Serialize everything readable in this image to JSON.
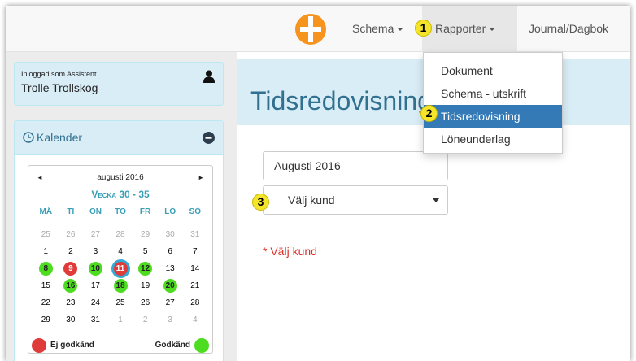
{
  "navbar": {
    "menu_items": [
      {
        "label": "Schema"
      },
      {
        "label": "Rapporter"
      },
      {
        "label": "Journal/Dagbok"
      }
    ]
  },
  "dropdown": {
    "items": [
      {
        "label": "Dokument"
      },
      {
        "label": "Schema - utskrift"
      },
      {
        "label": "Tidsredovisning",
        "active": true
      },
      {
        "label": "Löneunderlag"
      }
    ]
  },
  "markers": [
    "1",
    "2",
    "3"
  ],
  "user_panel": {
    "logged_in_label": "Inloggad som Assistent",
    "name": "Trolle Trollskog",
    "icon": "user-icon"
  },
  "calendar_panel": {
    "title": "Kalender",
    "month_label": "augusti 2016",
    "week_label": "Vecka 30 - 35",
    "weekdays": [
      "MÅ",
      "TI",
      "ON",
      "TO",
      "FR",
      "LÖ",
      "SÖ"
    ],
    "weeks": [
      [
        "25",
        "26",
        "27",
        "28",
        "29",
        "30",
        "31"
      ],
      [
        "1",
        "2",
        "3",
        "4",
        "5",
        "6",
        "7"
      ],
      [
        "8",
        "9",
        "10",
        "11",
        "12",
        "13",
        "14"
      ],
      [
        "15",
        "16",
        "17",
        "18",
        "19",
        "20",
        "21"
      ],
      [
        "22",
        "23",
        "24",
        "25",
        "26",
        "27",
        "28"
      ],
      [
        "29",
        "30",
        "31",
        "1",
        "2",
        "3",
        "4"
      ]
    ],
    "legend": {
      "not_approved": "Ej godkänd",
      "approved": "Godkänd"
    }
  },
  "main": {
    "page_title": "Tidsredovisning",
    "month_value": "Augusti 2016",
    "customer_select": "Välj kund",
    "validation_message": "* Välj kund"
  },
  "colors": {
    "accent": "#337ab7",
    "panel": "#d9edf7",
    "not_approved": "#e03b3b",
    "approved": "#4ddc1f",
    "error": "#e0302a",
    "marker": "#f4e52a"
  }
}
